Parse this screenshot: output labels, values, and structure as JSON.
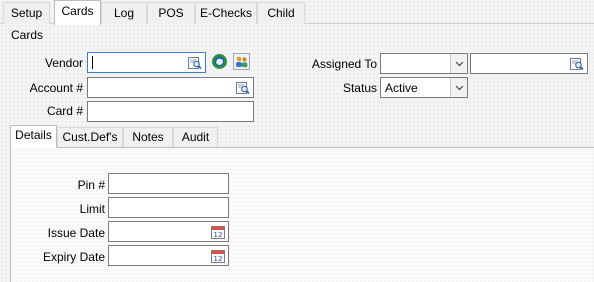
{
  "tabs": [
    "Setup",
    "Cards",
    "Log",
    "POS",
    "E-Checks",
    "Child"
  ],
  "active_tab": "Cards",
  "group_title": "Cards",
  "form": {
    "vendor_label": "Vendor",
    "vendor_value": "",
    "account_label": "Account #",
    "account_value": "",
    "card_label": "Card #",
    "card_value": "",
    "assigned_to_label": "Assigned To",
    "assigned_to_value": "",
    "assigned_to_text": "",
    "status_label": "Status",
    "status_value": "Active"
  },
  "inner_tabs": [
    "Details",
    "Cust.Def's",
    "Notes",
    "Audit"
  ],
  "active_inner_tab": "Details",
  "details": {
    "pin_label": "Pin #",
    "limit_label": "Limit",
    "issue_date_label": "Issue Date",
    "expiry_date_label": "Expiry Date",
    "calendar_day": "12"
  },
  "icons": {
    "lookup": "lookup-icon",
    "refresh": "refresh-globe-icon",
    "people": "people-icon",
    "dropdown": "chevron-down-icon",
    "calendar": "calendar-icon"
  }
}
